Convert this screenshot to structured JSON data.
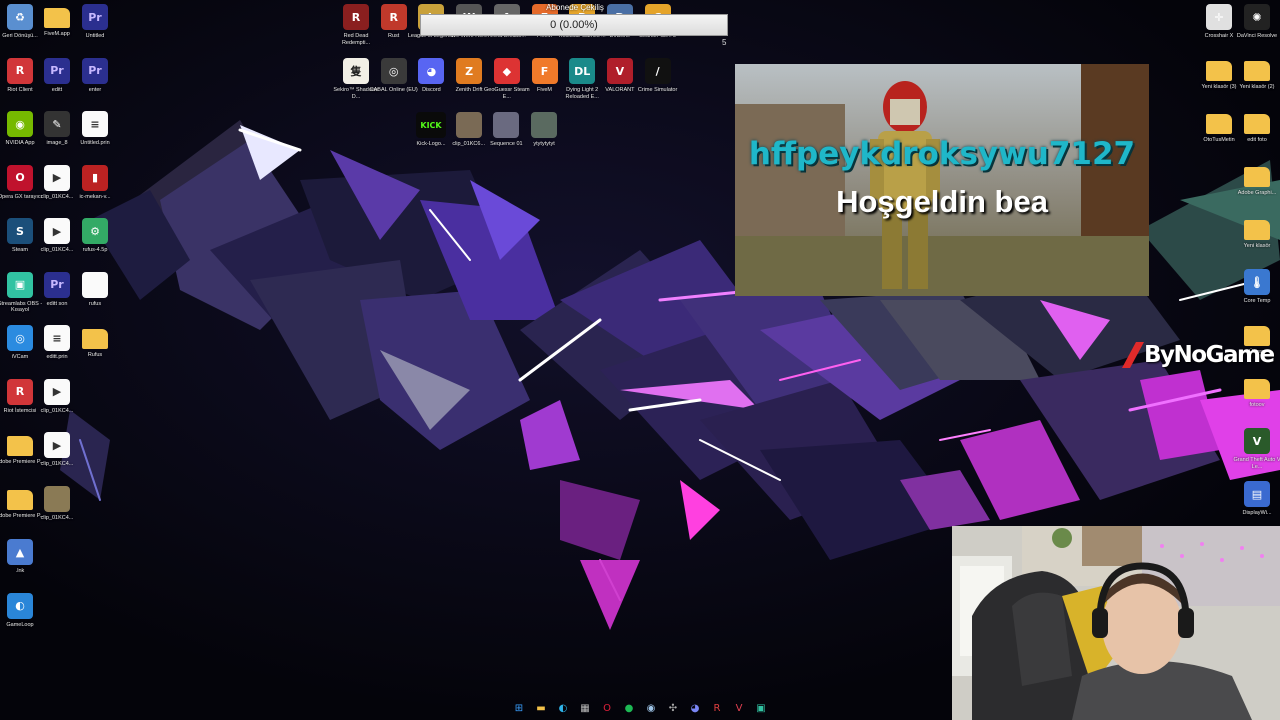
{
  "progress": {
    "heading": "Abonede Çekiliş",
    "text": "0 (0.00%)",
    "side_value": "5"
  },
  "alert": {
    "username": "hffpeykdroksywu7127",
    "message": "Hoşgeldin bea"
  },
  "watermark": {
    "text": "ByNoGame"
  },
  "desktop_icons": {
    "col1": [
      {
        "label": "Geri Dönüşü...",
        "icon": "recycle-bin-icon",
        "color": "#5a8fd0",
        "glyph": "♻"
      },
      {
        "label": "Riot Client",
        "icon": "riot-icon",
        "color": "#d13639",
        "glyph": "R"
      },
      {
        "label": "NVIDIA App",
        "icon": "nvidia-icon",
        "color": "#76b900",
        "glyph": "◉"
      },
      {
        "label": "Opera GX tarayıcı",
        "icon": "opera-icon",
        "color": "#c0122d",
        "glyph": "O"
      },
      {
        "label": "Steam",
        "icon": "steam-icon",
        "color": "#1b4f7a",
        "glyph": "S"
      },
      {
        "label": "Streamlabs OBS - Kısayol",
        "icon": "streamlabs-icon",
        "color": "#31c3a2",
        "glyph": "▣"
      },
      {
        "label": "iVCam",
        "icon": "ivcam-icon",
        "color": "#2b8be0",
        "glyph": "◎"
      },
      {
        "label": "Riot İstemcisi",
        "icon": "riot-client-icon",
        "color": "#d13639",
        "glyph": "R"
      },
      {
        "label": "Adobe Premiere P...",
        "icon": "folder-icon",
        "color": "#f3c24a",
        "glyph": ""
      },
      {
        "label": "Adobe Premiere P...",
        "icon": "folder-icon",
        "color": "#f3c24a",
        "glyph": ""
      },
      {
        "label": ".lnk",
        "icon": "game-shortcut-icon",
        "color": "#4a7bd0",
        "glyph": "▲"
      },
      {
        "label": "GameLoop",
        "icon": "gameloop-icon",
        "color": "#2a86d8",
        "glyph": "◐"
      }
    ],
    "col2": [
      {
        "label": "FiveM.app",
        "icon": "folder-icon",
        "color": "#f3c24a",
        "glyph": ""
      },
      {
        "label": "editt",
        "icon": "premiere-project-icon",
        "color": "#2b2f8f",
        "glyph": "Pr"
      },
      {
        "label": "image_8",
        "icon": "image-icon",
        "color": "#333",
        "glyph": "✎"
      },
      {
        "label": "clip_01KC4...",
        "icon": "video-icon",
        "color": "#fafafa",
        "glyph": "▶"
      },
      {
        "label": "clip_01KC4...",
        "icon": "video-icon",
        "color": "#fafafa",
        "glyph": "▶"
      },
      {
        "label": "editt son",
        "icon": "premiere-project-icon",
        "color": "#2b2f8f",
        "glyph": "Pr"
      },
      {
        "label": "editt.prin",
        "icon": "document-icon",
        "color": "#fafafa",
        "glyph": "≡"
      },
      {
        "label": "clip_01KC4...",
        "icon": "video-icon",
        "color": "#fafafa",
        "glyph": "▶"
      },
      {
        "label": "clip_01KC4...",
        "icon": "video-icon",
        "color": "#fafafa",
        "glyph": "▶"
      },
      {
        "label": "clip_01KC4...",
        "icon": "thumbnail-icon",
        "color": "#8a7a55",
        "glyph": ""
      }
    ],
    "col3": [
      {
        "label": "Untitled",
        "icon": "premiere-project-icon",
        "color": "#2b2f8f",
        "glyph": "Pr"
      },
      {
        "label": "enter",
        "icon": "premiere-project-icon",
        "color": "#2b2f8f",
        "glyph": "Pr"
      },
      {
        "label": "Untitled.prin",
        "icon": "document-icon",
        "color": "#fafafa",
        "glyph": "≡"
      },
      {
        "label": "ic-mekan-v...",
        "icon": "image-icon",
        "color": "#b22",
        "glyph": "▮"
      },
      {
        "label": "rufus-4.5p",
        "icon": "rufus-icon",
        "color": "#3a6",
        "glyph": "⚙"
      },
      {
        "label": "rufus",
        "icon": "file-icon",
        "color": "#fafafa",
        "glyph": ""
      },
      {
        "label": "Rufus",
        "icon": "folder-icon",
        "color": "#f3c24a",
        "glyph": ""
      }
    ],
    "top_row1": [
      {
        "label": "Red Dead Redempti...",
        "icon": "rdr-icon",
        "color": "#8a1f1f",
        "glyph": "R"
      },
      {
        "label": "Rust",
        "icon": "rust-icon",
        "color": "#c0392b",
        "glyph": "R"
      },
      {
        "label": "League of Legends",
        "icon": "lol-icon",
        "color": "#c9a13b",
        "glyph": "L"
      },
      {
        "label": "We Were Here",
        "icon": "game-icon",
        "color": "#555",
        "glyph": "W"
      },
      {
        "label": "Arena Breako...",
        "icon": "game-icon",
        "color": "#666",
        "glyph": "A"
      },
      {
        "label": "FiveM",
        "icon": "fivem-icon",
        "color": "#e56a2a",
        "glyph": "F"
      },
      {
        "label": "Rockstar Games ...",
        "icon": "rockstar-icon",
        "color": "#e5a42a",
        "glyph": "R"
      },
      {
        "label": "Dirtzone",
        "icon": "game-icon",
        "color": "#4a6fa5",
        "glyph": "D"
      },
      {
        "label": "Counter-Str... 2",
        "icon": "cs2-icon",
        "color": "#e5a42a",
        "glyph": "C"
      }
    ],
    "top_row2": [
      {
        "label": "Sekiro™ Shadows D...",
        "icon": "sekiro-icon",
        "color": "#f2efe6",
        "glyph": "隻"
      },
      {
        "label": "CABAL Online (EU)",
        "icon": "cabal-icon",
        "color": "#3a3a3a",
        "glyph": "◎"
      },
      {
        "label": "Discord",
        "icon": "discord-icon",
        "color": "#5865f2",
        "glyph": "◕"
      },
      {
        "label": "Zenith Drift",
        "icon": "game-icon",
        "color": "#e07b20",
        "glyph": "Z"
      },
      {
        "label": "GeoGuessr Steam E...",
        "icon": "geoguessr-icon",
        "color": "#d33",
        "glyph": "◆"
      },
      {
        "label": "FiveM",
        "icon": "fivem-icon",
        "color": "#f07a2a",
        "glyph": "F"
      },
      {
        "label": "Dying Light 2 Reloaded E...",
        "icon": "dying-light-icon",
        "color": "#1a8a8a",
        "glyph": "DL"
      },
      {
        "label": "VALORANT",
        "icon": "valorant-icon",
        "color": "#b01e2a",
        "glyph": "V"
      },
      {
        "label": "Crime Simulator",
        "icon": "game-icon",
        "color": "#111",
        "glyph": "/"
      }
    ],
    "top_row3": [
      {
        "label": "Kick-Logo...",
        "icon": "kick-icon",
        "color": "#0a0a0a",
        "glyph": "KICK"
      },
      {
        "label": "clip_01KC6...",
        "icon": "thumbnail-icon",
        "color": "#7a6a55",
        "glyph": ""
      },
      {
        "label": "Sequence 01",
        "icon": "thumbnail-icon",
        "color": "#6a6a80",
        "glyph": ""
      },
      {
        "label": "ytytytytyt",
        "icon": "thumbnail-icon",
        "color": "#5a6a60",
        "glyph": ""
      }
    ],
    "right_col1": [
      {
        "label": "Crosshair X",
        "icon": "crosshair-icon",
        "color": "#e0e0e0",
        "glyph": "✛"
      },
      {
        "label": "Yeni klasör (3)",
        "icon": "folder-icon",
        "color": "#f3c24a",
        "glyph": ""
      },
      {
        "label": "OtoTusMetin",
        "icon": "folder-icon",
        "color": "#f3c24a",
        "glyph": ""
      }
    ],
    "right_col2": [
      {
        "label": "DaVinci Resolve",
        "icon": "davinci-icon",
        "color": "#222",
        "glyph": "✺"
      },
      {
        "label": "Yeni klasör (2)",
        "icon": "folder-icon",
        "color": "#f3c24a",
        "glyph": ""
      },
      {
        "label": "edit foto",
        "icon": "folder-icon",
        "color": "#f3c24a",
        "glyph": ""
      },
      {
        "label": "Adobe Graphi...",
        "icon": "folder-icon",
        "color": "#f3c24a",
        "glyph": ""
      },
      {
        "label": "Yeni klasör",
        "icon": "folder-icon",
        "color": "#f3c24a",
        "glyph": ""
      },
      {
        "label": "Core Temp",
        "icon": "core-temp-icon",
        "color": "#3a78d0",
        "glyph": "🌡"
      },
      {
        "label": "Ünvan",
        "icon": "folder-icon",
        "color": "#f3c24a",
        "glyph": ""
      },
      {
        "label": "fotoov",
        "icon": "folder-icon",
        "color": "#f3c24a",
        "glyph": ""
      },
      {
        "label": "Grand Theft Auto V Le...",
        "icon": "gta-icon",
        "color": "#2a5a2a",
        "glyph": "V"
      },
      {
        "label": "DisplayWi...",
        "icon": "display-icon",
        "color": "#3a6ad0",
        "glyph": "▤"
      }
    ]
  },
  "taskbar": [
    {
      "name": "start-icon",
      "glyph": "⊞",
      "color": "#3aa0ff"
    },
    {
      "name": "file-explorer-icon",
      "glyph": "▬",
      "color": "#f3c24a"
    },
    {
      "name": "edge-icon",
      "glyph": "◐",
      "color": "#2fb3e8"
    },
    {
      "name": "store-icon",
      "glyph": "▦",
      "color": "#bbb"
    },
    {
      "name": "opera-gx-icon",
      "glyph": "O",
      "color": "#e0203a"
    },
    {
      "name": "spotify-icon",
      "glyph": "●",
      "color": "#1db954"
    },
    {
      "name": "steam-icon",
      "glyph": "◉",
      "color": "#9fc5e8"
    },
    {
      "name": "network-icon",
      "glyph": "✣",
      "color": "#aaa"
    },
    {
      "name": "discord-icon",
      "glyph": "◕",
      "color": "#7a86f5"
    },
    {
      "name": "riot-icon",
      "glyph": "R",
      "color": "#e04040"
    },
    {
      "name": "valorant-icon",
      "glyph": "V",
      "color": "#e04050"
    },
    {
      "name": "streamlabs-icon",
      "glyph": "▣",
      "color": "#31c3a2"
    }
  ]
}
